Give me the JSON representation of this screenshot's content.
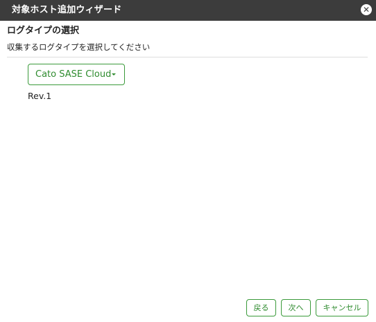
{
  "dialog": {
    "title": "対象ホスト追加ウィザード",
    "close_icon": "close-icon"
  },
  "section": {
    "title": "ログタイプの選択",
    "description": "収集するログタイプを選択してください"
  },
  "log_type_select": {
    "selected": "Cato SASE Cloud",
    "caret_icon": "caret-down-icon"
  },
  "revision": "Rev.1",
  "footer": {
    "back_label": "戻る",
    "next_label": "次へ",
    "cancel_label": "キャンセル"
  },
  "colors": {
    "titlebar_bg": "#3c3c3c",
    "accent": "#2e8b2e",
    "border_accent": "#3a9a3a"
  }
}
